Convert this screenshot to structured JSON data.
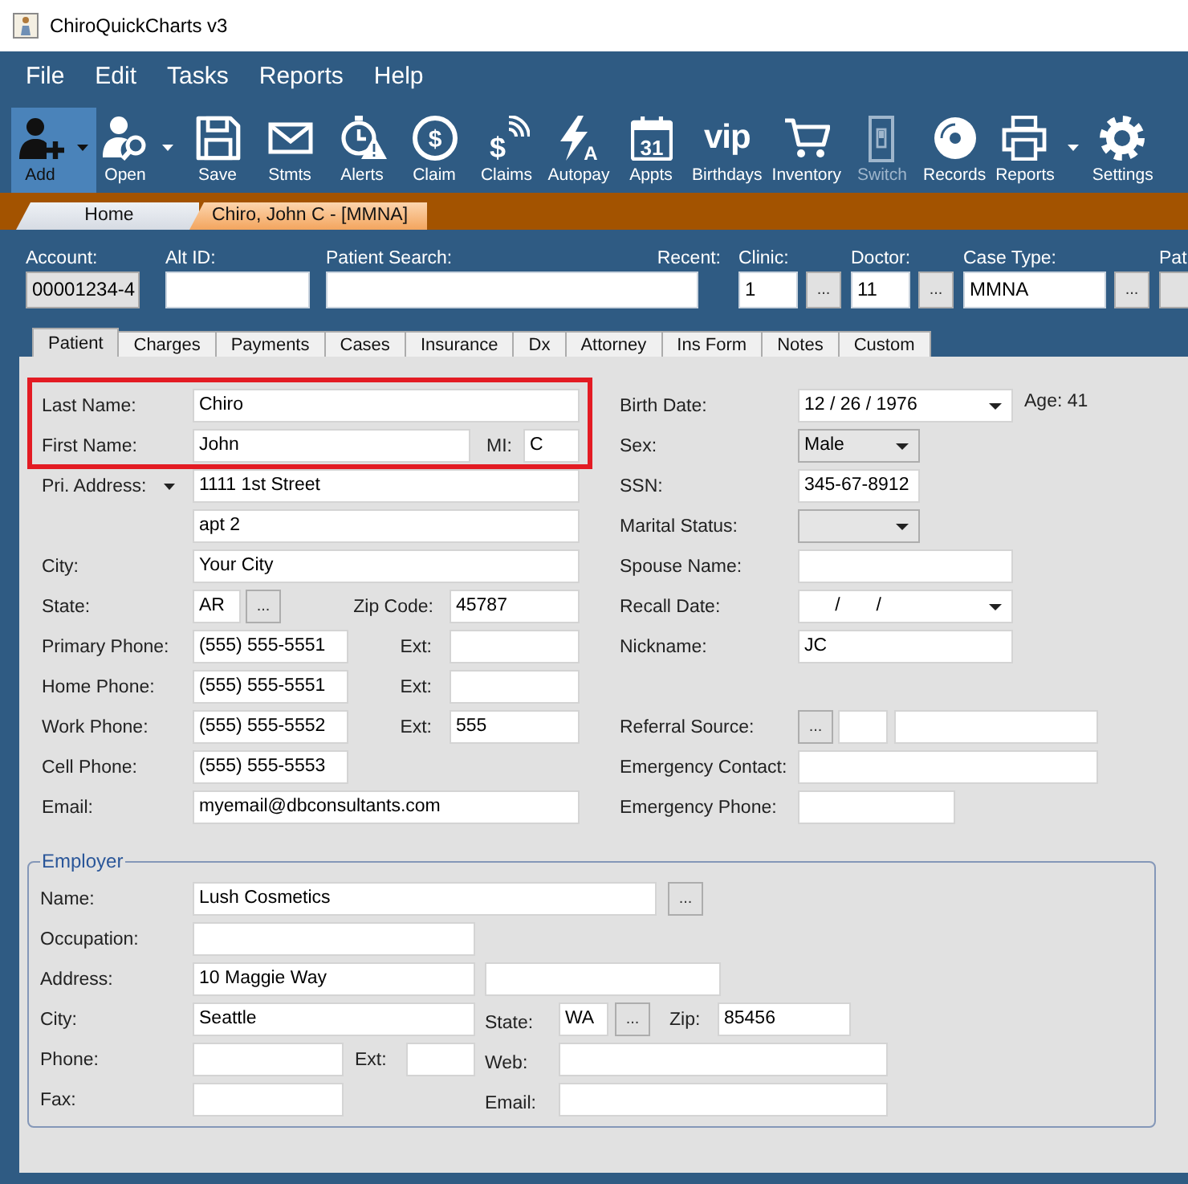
{
  "window": {
    "title": "ChiroQuickCharts v3"
  },
  "menu": [
    "File",
    "Edit",
    "Tasks",
    "Reports",
    "Help"
  ],
  "toolbar": [
    {
      "label": "Add",
      "kind": "dropdown",
      "selected": true,
      "disabled": false
    },
    {
      "label": "Open",
      "kind": "dropdown",
      "selected": false,
      "disabled": false
    },
    {
      "label": "Save",
      "kind": "button",
      "selected": false,
      "disabled": false
    },
    {
      "label": "Stmts",
      "kind": "button",
      "selected": false,
      "disabled": false
    },
    {
      "label": "Alerts",
      "kind": "button",
      "selected": false,
      "disabled": false
    },
    {
      "label": "Claim",
      "kind": "button",
      "selected": false,
      "disabled": false,
      "icon_text": "$"
    },
    {
      "label": "Claims",
      "kind": "button",
      "selected": false,
      "disabled": false,
      "icon_text": "$"
    },
    {
      "label": "Autopay",
      "kind": "button",
      "selected": false,
      "disabled": false,
      "icon_text": "A"
    },
    {
      "label": "Appts",
      "kind": "button",
      "selected": false,
      "disabled": false,
      "icon_text": "31"
    },
    {
      "label": "Birthdays",
      "kind": "button",
      "selected": false,
      "disabled": false,
      "icon_text": "vip"
    },
    {
      "label": "Inventory",
      "kind": "button",
      "selected": false,
      "disabled": false
    },
    {
      "label": "Switch",
      "kind": "button",
      "selected": false,
      "disabled": true
    },
    {
      "label": "Records",
      "kind": "button",
      "selected": false,
      "disabled": false
    },
    {
      "label": "Reports",
      "kind": "dropdown",
      "selected": false,
      "disabled": false
    },
    {
      "label": "Settings",
      "kind": "button",
      "selected": false,
      "disabled": false
    }
  ],
  "document_tabs": [
    {
      "label": "Home",
      "selected": false
    },
    {
      "label": "Chiro, John C - [MMNA]",
      "selected": true
    }
  ],
  "header": {
    "account": {
      "label": "Account:",
      "value": "00001234-4"
    },
    "alt_id": {
      "label": "Alt ID:"
    },
    "patient_search": {
      "label": "Patient Search:"
    },
    "recent": {
      "label": "Recent:"
    },
    "clinic": {
      "label": "Clinic:",
      "value": "1",
      "button": "..."
    },
    "doctor": {
      "label": "Doctor:",
      "value": "11",
      "button": "..."
    },
    "case_type": {
      "label": "Case Type:",
      "value": "MMNA",
      "button": "..."
    },
    "column_7": {
      "label": "Pat"
    }
  },
  "tabs": [
    {
      "label": "Patient",
      "selected": true
    },
    {
      "label": "Charges",
      "selected": false
    },
    {
      "label": "Payments",
      "selected": false
    },
    {
      "label": "Cases",
      "selected": false
    },
    {
      "label": "Insurance",
      "selected": false
    },
    {
      "label": "Dx",
      "selected": false
    },
    {
      "label": "Attorney",
      "selected": false
    },
    {
      "label": "Ins Form",
      "selected": false
    },
    {
      "label": "Notes",
      "selected": false
    },
    {
      "label": "Custom",
      "selected": false
    }
  ],
  "patient": {
    "name_highlighted": true,
    "last_name": {
      "label": "Last Name:",
      "value": "Chiro"
    },
    "first_name": {
      "label": "First Name:",
      "value": "John"
    },
    "mi": {
      "label": "MI:",
      "value": "C"
    },
    "address": {
      "label": "Pri. Address:",
      "line_1": "1111 1st Street",
      "line_2": "apt 2"
    },
    "city": {
      "label": "City:",
      "value": "Your City"
    },
    "state": {
      "label": "State:",
      "value": "AR",
      "button": "..."
    },
    "zip": {
      "label": "Zip Code:",
      "value": "45787"
    },
    "phones": [
      {
        "label": "Primary Phone:",
        "value": "(555) 555-5551",
        "ext_label": "Ext:"
      },
      {
        "label": "Home Phone:",
        "value": "(555) 555-5551",
        "ext_label": "Ext:"
      },
      {
        "label": "Work Phone:",
        "value": "(555) 555-5552",
        "ext_label": "Ext:",
        "ext": "555"
      },
      {
        "label": "Cell Phone:",
        "value": "(555) 555-5553"
      }
    ],
    "email": {
      "label": "Email:",
      "value": "myemail@dbconsultants.com"
    },
    "birth_date": {
      "label": "Birth Date:",
      "value": "12 / 26 / 1976"
    },
    "age": "Age: 41",
    "sex": {
      "label": "Sex:",
      "value": "Male"
    },
    "ssn": {
      "label": "SSN:",
      "value": "345-67-8912"
    },
    "marital_status": {
      "label": "Marital Status:"
    },
    "spouse_name": {
      "label": "Spouse Name:"
    },
    "recall_date": {
      "label": "Recall Date:",
      "value": "      /       /"
    },
    "nickname": {
      "label": "Nickname:",
      "value": "JC"
    },
    "referral_source": {
      "label": "Referral Source:",
      "button": "..."
    },
    "emergency_contact": {
      "label": "Emergency Contact:"
    },
    "emergency_phone": {
      "label": "Emergency Phone:"
    }
  },
  "employer": {
    "title": "Employer",
    "name": {
      "label": "Name:",
      "value": "Lush Cosmetics",
      "button": "..."
    },
    "occupation": {
      "label": "Occupation:"
    },
    "address": {
      "label": "Address:",
      "line_1": "10 Maggie Way"
    },
    "city": {
      "label": "City:",
      "value": "Seattle"
    },
    "state": {
      "label": "State:",
      "value": "WA",
      "button": "..."
    },
    "zip": {
      "label": "Zip:",
      "value": "85456"
    },
    "phone": {
      "label": "Phone:"
    },
    "ext": {
      "label": "Ext:"
    },
    "web": {
      "label": "Web:"
    },
    "fax": {
      "label": "Fax:"
    },
    "email": {
      "label": "Email:"
    }
  }
}
